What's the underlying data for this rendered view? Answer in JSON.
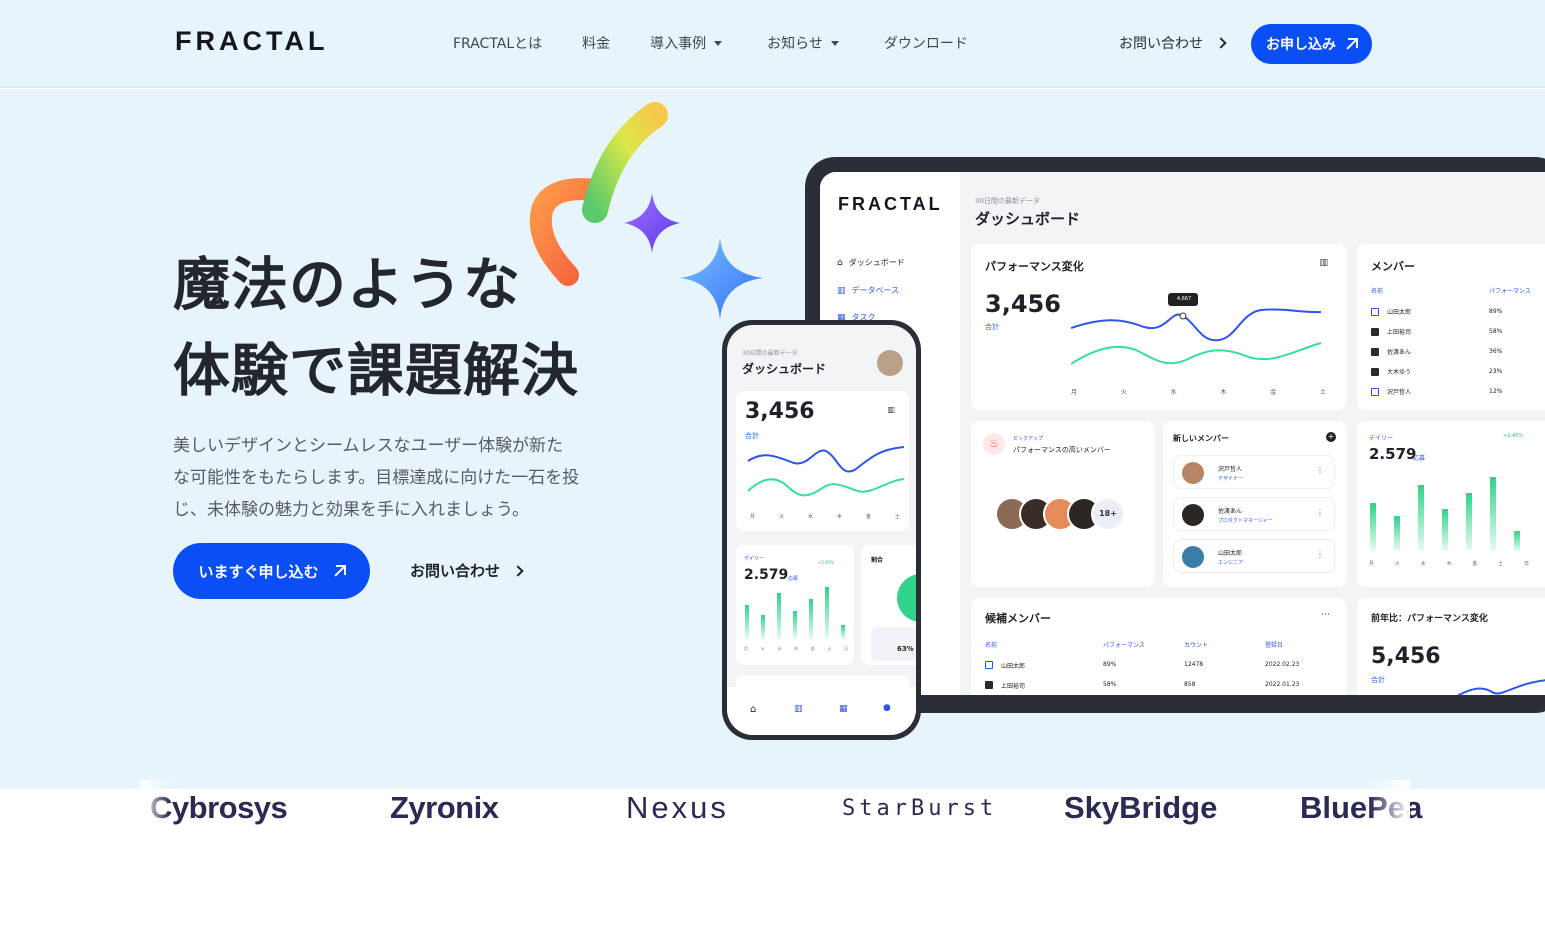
{
  "header": {
    "logo": "FRACTAL",
    "nav": [
      {
        "label": "FRACTALとは",
        "dropdown": false
      },
      {
        "label": "料金",
        "dropdown": false
      },
      {
        "label": "導入事例",
        "dropdown": true
      },
      {
        "label": "お知らせ",
        "dropdown": true
      },
      {
        "label": "ダウンロード",
        "dropdown": false
      }
    ],
    "contact": "お問い合わせ",
    "apply": "お申し込み"
  },
  "hero": {
    "headline_line1": "魔法のような",
    "headline_line2": "体験で課題解決",
    "subtext_line1": "美しいデザインとシームレスなユーザー体験が新た",
    "subtext_line2": "な可能性をもたらします。目標達成に向けた一石を投",
    "subtext_line3": "じ、未体験の魅力と効果を手に入れましょう。",
    "cta_primary": "いますぐ申し込む",
    "cta_secondary": "お問い合わせ"
  },
  "tablet": {
    "logo": "FRACTAL",
    "sidebar": [
      "ダッシュボード",
      "データベース",
      "タスク"
    ],
    "header_sub": "30日間の最新データ",
    "header_title": "ダッシュボード",
    "performance": {
      "title": "パフォーマンス変化",
      "value": "3,456",
      "label": "合計",
      "tooltip": "4,667",
      "days": [
        "月",
        "火",
        "水",
        "木",
        "金",
        "土"
      ]
    },
    "members": {
      "title": "メンバー",
      "col_name": "名前",
      "col_perf": "パフォーマンス",
      "rows": [
        {
          "name": "山田太郎",
          "pct": "89%",
          "checked": false
        },
        {
          "name": "上田裕司",
          "pct": "58%",
          "checked": true
        },
        {
          "name": "佐渡あん",
          "pct": "36%",
          "checked": true
        },
        {
          "name": "大木ゆう",
          "pct": "23%",
          "checked": true
        },
        {
          "name": "沢戸哲人",
          "pct": "12%",
          "checked": false
        }
      ]
    },
    "pickup": {
      "tag": "ピックアップ",
      "title": "パフォーマンスの高いメンバー",
      "more": "18+"
    },
    "new_members": {
      "title": "新しいメンバー",
      "rows": [
        {
          "name": "沢戸哲人",
          "role": "デザイナー"
        },
        {
          "name": "佐渡あん",
          "role": "プロダクトマネージャー"
        },
        {
          "name": "山田太郎",
          "role": "エンジニア"
        }
      ]
    },
    "daily": {
      "label": "デイリー",
      "change": "+2.45%",
      "value": "2.579",
      "unit": "応募",
      "days": [
        "月",
        "火",
        "水",
        "木",
        "金",
        "土",
        "日"
      ]
    },
    "candidates": {
      "title": "候補メンバー",
      "cols": [
        "名前",
        "パフォーマンス",
        "カウント",
        "登録日"
      ],
      "rows": [
        {
          "name": "山田太郎",
          "perf": "89%",
          "count": "12478",
          "date": "2022.02.23",
          "checked": false
        },
        {
          "name": "上田裕司",
          "perf": "58%",
          "count": "858",
          "date": "2022.01.23",
          "checked": true
        }
      ]
    },
    "yoy": {
      "title": "前年比：パフォーマンス変化",
      "value": "5,456",
      "label": "合計"
    }
  },
  "phone": {
    "header_sub": "30日間の最新データ",
    "header_title": "ダッシュボード",
    "value": "3,456",
    "label": "合計",
    "days": [
      "月",
      "火",
      "水",
      "木",
      "金",
      "土"
    ],
    "daily_label": "デイリー",
    "daily_change": "+2.45%",
    "daily_value": "2.579",
    "daily_unit": "応募",
    "daily_days": [
      "月",
      "火",
      "水",
      "木",
      "金",
      "土",
      "日"
    ],
    "ratio_label": "割合",
    "ratio_value": "63%"
  },
  "logos": [
    "Cybrosys",
    "Zyronix",
    "Nexus",
    "StarBurst",
    "SkyBridge",
    "BluePea"
  ],
  "colors": {
    "accent": "#0a4ef5",
    "hero_bg": "#e8f4fc",
    "line_blue": "#2f55e6",
    "line_green": "#3ddc97"
  }
}
